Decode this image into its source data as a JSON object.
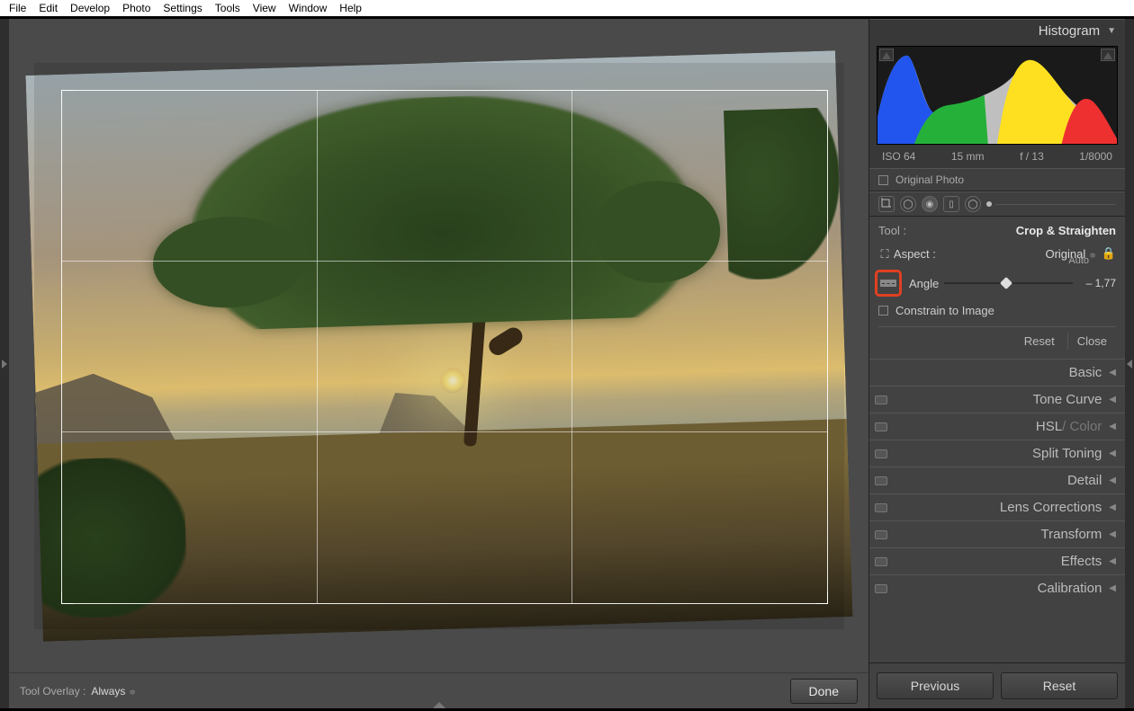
{
  "menu": [
    "File",
    "Edit",
    "Develop",
    "Photo",
    "Settings",
    "Tools",
    "View",
    "Window",
    "Help"
  ],
  "histogram": {
    "title": "Histogram",
    "exif": {
      "iso": "ISO 64",
      "focal": "15 mm",
      "aperture": "f / 13",
      "shutter": "1/8000"
    },
    "original_photo_label": "Original Photo"
  },
  "tool": {
    "label": "Tool :",
    "name": "Crop & Straighten"
  },
  "aspect": {
    "label": "Aspect :",
    "value": "Original"
  },
  "angle": {
    "label": "Angle",
    "auto": "Auto",
    "value": "– 1,77"
  },
  "constrain": {
    "label": "Constrain to Image"
  },
  "buttons": {
    "reset": "Reset",
    "close": "Close"
  },
  "panels": [
    {
      "label": "Basic",
      "hsl": false,
      "sw": false
    },
    {
      "label": "Tone Curve",
      "hsl": false,
      "sw": true
    },
    {
      "label_a": "HSL",
      "label_b": " / Color",
      "hsl": true,
      "sw": true
    },
    {
      "label": "Split Toning",
      "hsl": false,
      "sw": true
    },
    {
      "label": "Detail",
      "hsl": false,
      "sw": true
    },
    {
      "label": "Lens Corrections",
      "hsl": false,
      "sw": true
    },
    {
      "label": "Transform",
      "hsl": false,
      "sw": true
    },
    {
      "label": "Effects",
      "hsl": false,
      "sw": true
    },
    {
      "label": "Calibration",
      "hsl": false,
      "sw": true
    }
  ],
  "bottom_buttons": {
    "previous": "Previous",
    "reset": "Reset"
  },
  "toolbar": {
    "overlay_label": "Tool Overlay :",
    "overlay_value": "Always",
    "done": "Done"
  }
}
